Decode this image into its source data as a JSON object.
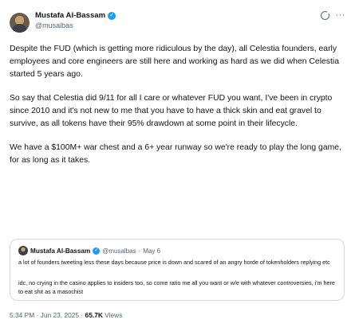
{
  "author": {
    "display_name": "Mustafa Al-Bassam",
    "handle": "@musalbas",
    "verified_mark": "✓"
  },
  "icons": {
    "grok": "grok-icon",
    "more": "more-icon"
  },
  "tweet": {
    "paragraphs": [
      "Despite the FUD (which is getting more ridiculous by the day), all Celestia founders, early employees and core engineers are still here and working as hard as we did when Celestia started 5 years ago.",
      "So say that Celestia did 9/11 for all I care or whatever FUD you want, I've been in crypto since 2010 and it's not new to me that you have to have a thick skin and eat gravel to survive, as all tokens have their 95% drawdown at some point in their lifecycle.",
      "We have a $100M+ war chest and a 6+ year runway so we're ready to play the long game, for as long as it takes."
    ]
  },
  "quoted_tweet": {
    "display_name": "Mustafa Al-Bassam",
    "handle": "@musalbas",
    "separator": "·",
    "date": "May 6",
    "paragraphs": [
      "a lot of founders tweeting less these days because price is down and scared of an angry horde of tokenholders replying etc",
      "idc, no crying in the casino applies to insiders too, so come ratio me all you want or w/e with whatever controversies, i'm here to eat shit as a masochist"
    ]
  },
  "meta": {
    "time": "5:34 PM",
    "separator": "·",
    "date": "Jun 23, 2025",
    "views_count": "65.7K",
    "views_label": "Views"
  },
  "colors": {
    "text": "#0f1419",
    "secondary": "#536471",
    "verified": "#1d9bf0",
    "border": "#cfd9de"
  }
}
